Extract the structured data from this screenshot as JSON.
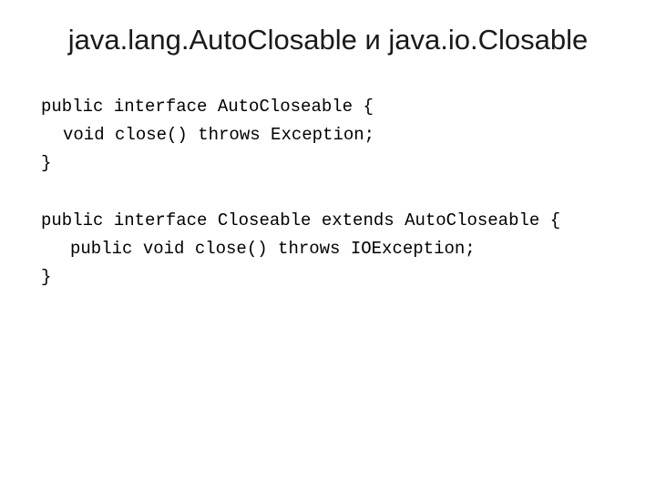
{
  "title": "java.lang.AutoClosable и java.io.Closable",
  "code": {
    "line1": "public interface AutoCloseable {",
    "line2": "void close() throws Exception;",
    "line3": "}",
    "line4": "public interface Closeable extends AutoCloseable {",
    "line5": "public void close() throws IOException;",
    "line6": "}"
  }
}
